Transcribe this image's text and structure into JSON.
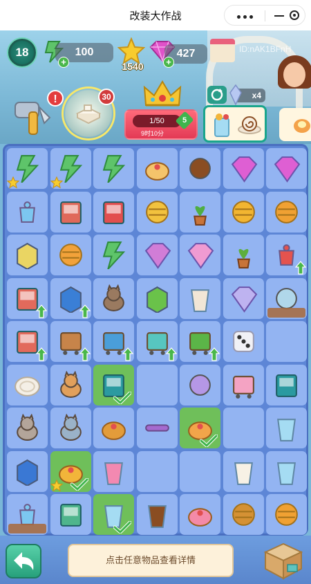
{
  "titlebar": {
    "title": "改装大作战"
  },
  "hud": {
    "level": "18",
    "energy": "100",
    "stars": "1540",
    "gems": "427",
    "player_id": "ID:nAK1BFnH",
    "notice": "!",
    "inventory_count": "30",
    "refresh_multiplier": "x4"
  },
  "quest": {
    "progress": "1/50",
    "reward": "5",
    "timer": "9时10分"
  },
  "board": {
    "rows": [
      [
        {
          "icon": "energy-bundle-icon",
          "color": "#5ec46a",
          "star": true
        },
        {
          "icon": "energy-bundle-icon",
          "color": "#5ec46a",
          "star": true
        },
        {
          "icon": "energy-bundle-icon",
          "color": "#5ec46a"
        },
        {
          "icon": "bread-tray-icon",
          "color": "#f4c46b"
        },
        {
          "icon": "chestnut-icon",
          "color": "#8a4d22"
        },
        {
          "icon": "gem-pile-icon",
          "color": "#e35bd2"
        },
        {
          "icon": "gem-pile-icon",
          "color": "#e35bd2"
        }
      ],
      [
        {
          "icon": "perfume-bottle-icon",
          "color": "#7cc7f0"
        },
        {
          "icon": "bookshelf-cart-icon",
          "color": "#e0695a"
        },
        {
          "icon": "book-stack-icon",
          "color": "#e24f4f"
        },
        {
          "icon": "honey-bee-icon",
          "color": "#f2c23e"
        },
        {
          "icon": "potted-plant-icon",
          "color": "#4fae43"
        },
        {
          "icon": "honeycomb-icon",
          "color": "#f2b531"
        },
        {
          "icon": "beehive-house-icon",
          "color": "#f0a133"
        }
      ],
      [
        {
          "icon": "honey-cube-icon",
          "color": "#ead563"
        },
        {
          "icon": "honey-jar-icon",
          "color": "#f2a23a"
        },
        {
          "icon": "energy-bolt-icon",
          "color": "#5ec46a"
        },
        {
          "icon": "crystal-earrings-icon",
          "color": "#d57bd6"
        },
        {
          "icon": "crystal-gem-icon",
          "color": "#f59ad1"
        },
        {
          "icon": "seedling-icon",
          "color": "#5dae3d"
        },
        {
          "icon": "tea-set-icon",
          "color": "#e4534e",
          "upgrade": true
        }
      ],
      [
        {
          "icon": "book-cart-icon",
          "color": "#e26a5c",
          "upgrade": true
        },
        {
          "icon": "shopping-bag-icon",
          "color": "#3a7fd6",
          "upgrade": true
        },
        {
          "icon": "cat-sleeping-icon",
          "color": "#9a7a60"
        },
        {
          "icon": "green-cube-icon",
          "color": "#6ac24a"
        },
        {
          "icon": "teacup-icon",
          "color": "#f1e6d6"
        },
        {
          "icon": "crystal-shard-icon",
          "color": "#c1b3f0"
        },
        {
          "icon": "cobweb-bottle-icon",
          "color": "#b0d7ea",
          "locked": true
        }
      ],
      [
        {
          "icon": "book-cart-icon",
          "color": "#e26a5c",
          "upgrade": true
        },
        {
          "icon": "tea-cart-icon",
          "color": "#c7844a",
          "upgrade": true
        },
        {
          "icon": "gift-basket-icon",
          "color": "#4a9ed9",
          "upgrade": true
        },
        {
          "icon": "vending-cart-icon",
          "color": "#57c6c0",
          "upgrade": true
        },
        {
          "icon": "green-appliance-icon",
          "color": "#5bb548",
          "upgrade": true
        },
        {
          "icon": "dice-icon",
          "color": "#f1f1f6"
        },
        {
          "icon": "empty-slot",
          "color": ""
        }
      ],
      [
        {
          "icon": "plate-icon",
          "color": "#f4efe6"
        },
        {
          "icon": "calico-cat-icon",
          "color": "#e1a05c"
        },
        {
          "icon": "recipe-book-icon",
          "color": "#2b9aa0",
          "selected": true
        },
        {
          "icon": "empty-slot",
          "color": ""
        },
        {
          "icon": "recipe-cards-icon",
          "color": "#b597e6"
        },
        {
          "icon": "milk-carton-icon",
          "color": "#f4a3c3"
        },
        {
          "icon": "teal-book-icon",
          "color": "#2b9aa0"
        }
      ],
      [
        {
          "icon": "tabby-kitten-icon",
          "color": "#b3a59a"
        },
        {
          "icon": "grey-kitten-icon",
          "color": "#9ab2c8"
        },
        {
          "icon": "croissant-icon",
          "color": "#e39c3a"
        },
        {
          "icon": "rolling-pin-icon",
          "color": "#a56acf"
        },
        {
          "icon": "donut-icon",
          "color": "#f2a54a",
          "selected": true
        },
        {
          "icon": "empty-slot",
          "color": ""
        },
        {
          "icon": "water-glass-icon",
          "color": "#a5dcf3"
        }
      ],
      [
        {
          "icon": "blue-box-icon",
          "color": "#3a78d4"
        },
        {
          "icon": "fruit-tart-icon",
          "color": "#f2b53a",
          "selected": true,
          "star": true
        },
        {
          "icon": "cupcake-icon",
          "color": "#f389b1"
        },
        {
          "icon": "empty-slot",
          "color": ""
        },
        {
          "icon": "empty-slot",
          "color": ""
        },
        {
          "icon": "paper-cup-icon",
          "color": "#f7f1e5"
        },
        {
          "icon": "lemonade-glass-icon",
          "color": "#a5dcf3"
        }
      ],
      [
        {
          "icon": "cobweb-perfume-icon",
          "color": "#7cc7f0",
          "locked": true
        },
        {
          "icon": "picture-book-icon",
          "color": "#4fb58c"
        },
        {
          "icon": "lemonade-glass-icon",
          "color": "#a5dcf3",
          "selected": true
        },
        {
          "icon": "brown-cup-icon",
          "color": "#8a4d22"
        },
        {
          "icon": "strawberry-cake-icon",
          "color": "#f48aa8"
        },
        {
          "icon": "honey-dipper-icon",
          "color": "#d59134"
        },
        {
          "icon": "beehive-house-icon",
          "color": "#f0a133"
        }
      ]
    ]
  },
  "footer": {
    "hint": "点击任意物品查看详情"
  },
  "colors": {
    "board": "#5d86d6",
    "cell": "#93b4f2",
    "selected": "#6fbf5a",
    "accent": "#1aa58c"
  }
}
